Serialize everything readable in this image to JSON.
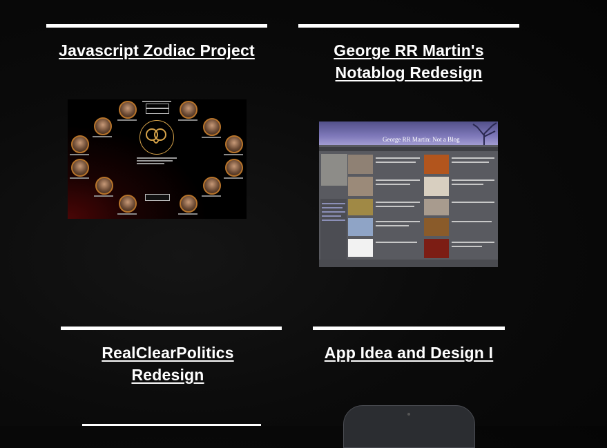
{
  "projects": [
    {
      "title_lines": [
        "Javascript Zodiac Project"
      ]
    },
    {
      "title_lines": [
        "George RR Martin's",
        "Notablog Redesign"
      ]
    },
    {
      "title_lines": [
        "RealClearPolitics",
        "Redesign"
      ]
    },
    {
      "title_lines": [
        "App Idea and Design I"
      ]
    }
  ],
  "zodiac_thumb": {
    "prompt": "Please enter your birthday",
    "button": "Submit",
    "welcome": "Welcome to the Wheel of Time Zodiac page",
    "cta": "Click here for Help"
  },
  "grrm_thumb": {
    "site_title": "George RR Martin: Not a Blog"
  },
  "colors": {
    "background": "#0b0b0b",
    "rule": "#ffffff",
    "title_text": "#ffffff",
    "grrm_header": "#7d77b8",
    "zodiac_gold": "#d8a44a"
  }
}
